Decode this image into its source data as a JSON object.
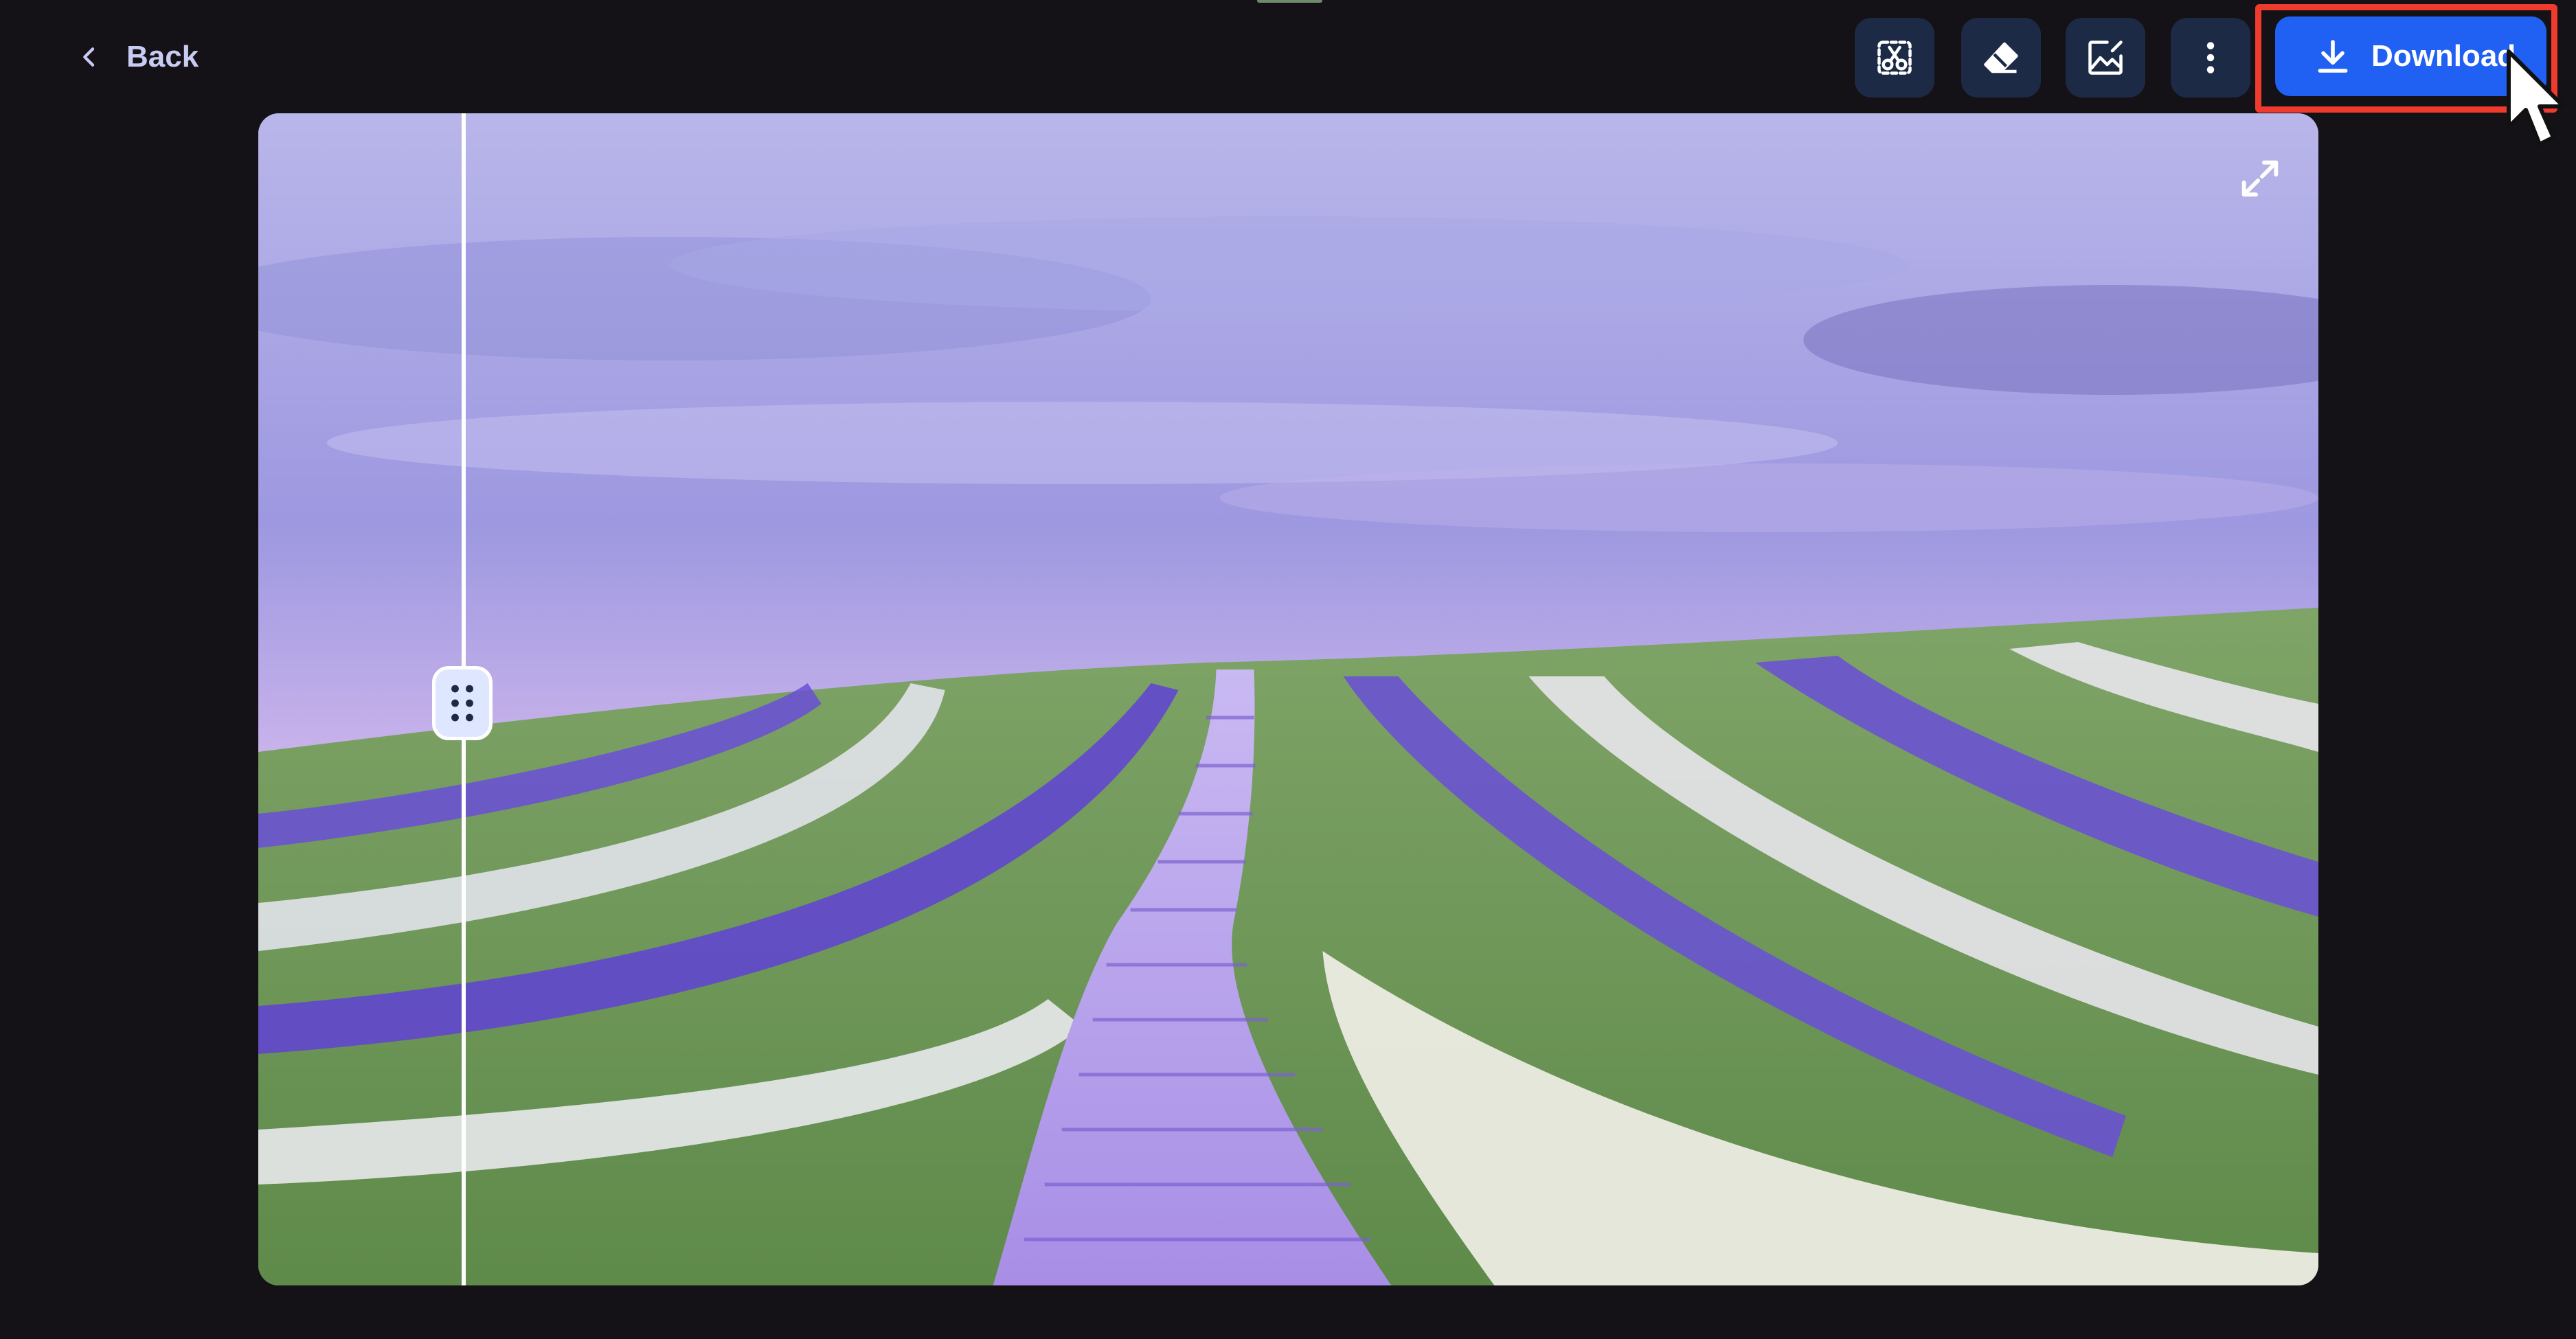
{
  "header": {
    "back_label": "Back",
    "download_label": "Download"
  },
  "toolbar": {
    "tools": [
      {
        "name": "remove-object-icon"
      },
      {
        "name": "eraser-icon"
      },
      {
        "name": "edit-image-icon"
      },
      {
        "name": "more-vertical-icon"
      }
    ]
  },
  "colors": {
    "background": "#141217",
    "accent": "#2060f2",
    "tool_button": "#1d2a46",
    "highlight": "#ef3a2e"
  },
  "comparison": {
    "handle_icon": "drag-handle-icon",
    "expand_icon": "expand-icon"
  }
}
